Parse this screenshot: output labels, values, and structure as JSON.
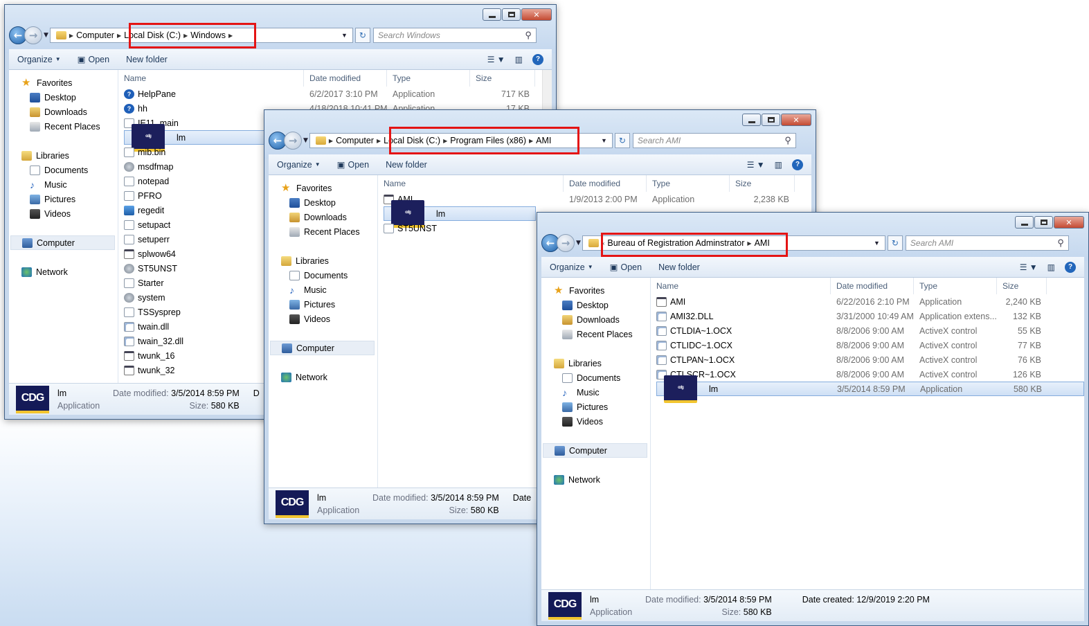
{
  "windows": [
    {
      "address": [
        "Computer",
        "Local Disk (C:)",
        "Windows"
      ],
      "search_placeholder": "Search Windows",
      "toolbar": {
        "organize": "Organize",
        "open": "Open",
        "new_folder": "New folder"
      },
      "nav": {
        "favorites": "Favorites",
        "desktop": "Desktop",
        "downloads": "Downloads",
        "recent": "Recent Places",
        "libraries": "Libraries",
        "documents": "Documents",
        "music": "Music",
        "pictures": "Pictures",
        "videos": "Videos",
        "computer": "Computer",
        "network": "Network"
      },
      "columns": {
        "name": "Name",
        "date": "Date modified",
        "type": "Type",
        "size": "Size"
      },
      "files": [
        {
          "name": "HelpPane",
          "date": "6/2/2017 3:10 PM",
          "type": "Application",
          "size": "717 KB",
          "icon": "help-icon"
        },
        {
          "name": "hh",
          "date": "4/18/2018 10:41 PM",
          "type": "Application",
          "size": "17 KB",
          "icon": "help-file-icon"
        },
        {
          "name": "IE11_main",
          "date": "",
          "type": "",
          "size": "",
          "icon": "document-icon"
        },
        {
          "name": "lm",
          "date": "",
          "type": "",
          "size": "",
          "icon": "cdg-icon"
        },
        {
          "name": "mib.bin",
          "date": "",
          "type": "",
          "size": "",
          "icon": "document-icon"
        },
        {
          "name": "msdfmap",
          "date": "",
          "type": "",
          "size": "",
          "icon": "settings-file-icon"
        },
        {
          "name": "notepad",
          "date": "",
          "type": "",
          "size": "",
          "icon": "notepad-icon"
        },
        {
          "name": "PFRO",
          "date": "",
          "type": "",
          "size": "",
          "icon": "document-icon"
        },
        {
          "name": "regedit",
          "date": "",
          "type": "",
          "size": "",
          "icon": "regedit-icon"
        },
        {
          "name": "setupact",
          "date": "",
          "type": "",
          "size": "",
          "icon": "document-icon"
        },
        {
          "name": "setuperr",
          "date": "",
          "type": "",
          "size": "",
          "icon": "document-icon"
        },
        {
          "name": "splwow64",
          "date": "",
          "type": "",
          "size": "",
          "icon": "app-icon"
        },
        {
          "name": "ST5UNST",
          "date": "",
          "type": "",
          "size": "",
          "icon": "setup-icon"
        },
        {
          "name": "Starter",
          "date": "",
          "type": "",
          "size": "",
          "icon": "document-icon"
        },
        {
          "name": "system",
          "date": "",
          "type": "",
          "size": "",
          "icon": "settings-file-icon"
        },
        {
          "name": "TSSysprep",
          "date": "",
          "type": "",
          "size": "",
          "icon": "document-icon"
        },
        {
          "name": "twain.dll",
          "date": "",
          "type": "",
          "size": "",
          "icon": "dll-icon"
        },
        {
          "name": "twain_32.dll",
          "date": "",
          "type": "",
          "size": "",
          "icon": "dll-icon"
        },
        {
          "name": "twunk_16",
          "date": "",
          "type": "",
          "size": "",
          "icon": "app-icon"
        },
        {
          "name": "twunk_32",
          "date": "",
          "type": "",
          "size": "",
          "icon": "app-icon"
        }
      ],
      "details": {
        "name": "lm",
        "kind": "Application",
        "modified_label": "Date modified:",
        "modified": "3/5/2014 8:59 PM",
        "size_label": "Size:",
        "size": "580 KB",
        "extra": "D"
      }
    },
    {
      "address": [
        "Computer",
        "Local Disk (C:)",
        "Program Files (x86)",
        "AMI"
      ],
      "search_placeholder": "Search AMI",
      "toolbar": {
        "organize": "Organize",
        "open": "Open",
        "new_folder": "New folder"
      },
      "nav": {
        "favorites": "Favorites",
        "desktop": "Desktop",
        "downloads": "Downloads",
        "recent": "Recent Places",
        "libraries": "Libraries",
        "documents": "Documents",
        "music": "Music",
        "pictures": "Pictures",
        "videos": "Videos",
        "computer": "Computer",
        "network": "Network"
      },
      "columns": {
        "name": "Name",
        "date": "Date modified",
        "type": "Type",
        "size": "Size"
      },
      "files": [
        {
          "name": "AMI",
          "date": "1/9/2013 2:00 PM",
          "type": "Application",
          "size": "2,238 KB",
          "icon": "app-icon"
        },
        {
          "name": "lm",
          "date": "",
          "type": "",
          "size": "",
          "icon": "cdg-icon"
        },
        {
          "name": "ST5UNST",
          "date": "",
          "type": "",
          "size": "",
          "icon": "document-icon"
        }
      ],
      "details": {
        "name": "lm",
        "kind": "Application",
        "modified_label": "Date modified:",
        "modified": "3/5/2014 8:59 PM",
        "size_label": "Size:",
        "size": "580 KB",
        "extra": "Date"
      }
    },
    {
      "address": [
        "Bureau of Registration Adminstrator",
        "AMI"
      ],
      "search_placeholder": "Search AMI",
      "toolbar": {
        "organize": "Organize",
        "open": "Open",
        "new_folder": "New folder"
      },
      "nav": {
        "favorites": "Favorites",
        "desktop": "Desktop",
        "downloads": "Downloads",
        "recent": "Recent Places",
        "libraries": "Libraries",
        "documents": "Documents",
        "music": "Music",
        "pictures": "Pictures",
        "videos": "Videos",
        "computer": "Computer",
        "network": "Network"
      },
      "columns": {
        "name": "Name",
        "date": "Date modified",
        "type": "Type",
        "size": "Size"
      },
      "files": [
        {
          "name": "AMI",
          "date": "6/22/2016 2:10 PM",
          "type": "Application",
          "size": "2,240 KB",
          "icon": "app-icon"
        },
        {
          "name": "AMI32.DLL",
          "date": "3/31/2000 10:49 AM",
          "type": "Application extens...",
          "size": "132 KB",
          "icon": "dll-icon"
        },
        {
          "name": "CTLDIA~1.OCX",
          "date": "8/8/2006 9:00 AM",
          "type": "ActiveX control",
          "size": "55 KB",
          "icon": "ocx-icon"
        },
        {
          "name": "CTLIDC~1.OCX",
          "date": "8/8/2006 9:00 AM",
          "type": "ActiveX control",
          "size": "77 KB",
          "icon": "ocx-icon"
        },
        {
          "name": "CTLPAN~1.OCX",
          "date": "8/8/2006 9:00 AM",
          "type": "ActiveX control",
          "size": "76 KB",
          "icon": "ocx-icon"
        },
        {
          "name": "CTLSCR~1.OCX",
          "date": "8/8/2006 9:00 AM",
          "type": "ActiveX control",
          "size": "126 KB",
          "icon": "ocx-icon"
        },
        {
          "name": "lm",
          "date": "3/5/2014 8:59 PM",
          "type": "Application",
          "size": "580 KB",
          "icon": "cdg-icon"
        }
      ],
      "details": {
        "name": "lm",
        "kind": "Application",
        "modified_label": "Date modified:",
        "modified": "3/5/2014 8:59 PM",
        "size_label": "Size:",
        "size": "580 KB",
        "created_label": "Date created:",
        "created": "12/9/2019 2:20 PM"
      }
    }
  ],
  "logo_text": "CDG",
  "colors": {
    "highlight_box": "#e41414",
    "selection": "#cfe0f5",
    "logo_bg": "#141a57"
  }
}
